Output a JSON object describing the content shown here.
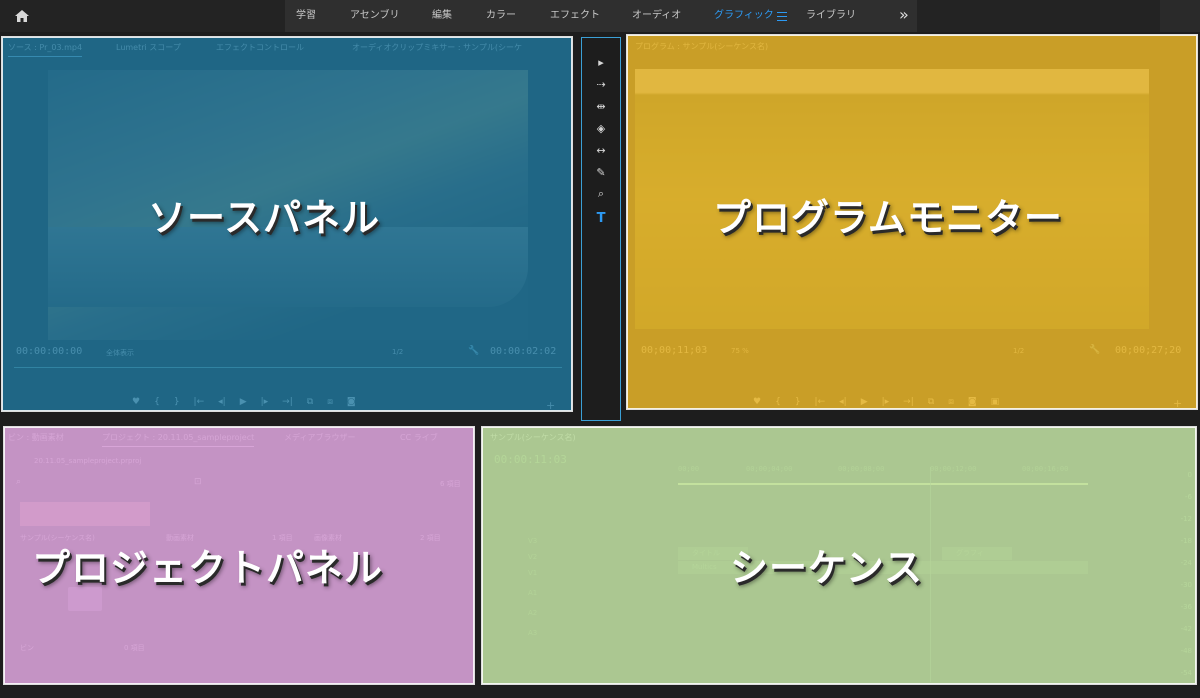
{
  "topbar": {
    "home_icon": "home-icon",
    "workspaces": [
      {
        "label": "学習"
      },
      {
        "label": "アセンブリ"
      },
      {
        "label": "編集"
      },
      {
        "label": "カラー"
      },
      {
        "label": "エフェクト"
      },
      {
        "label": "オーディオ"
      },
      {
        "label": "グラフィック",
        "active": true
      },
      {
        "label": "ライブラリ"
      }
    ],
    "more": "»"
  },
  "source_panel": {
    "tabs": [
      "ソース : Pr_03.mp4",
      "Lumetri スコープ",
      "エフェクトコントロール",
      "オーディオクリップミキサー : サンプル(シーケ"
    ],
    "overlay_title": "ソースパネル",
    "timecode_left": "00:00:00:00",
    "zoom": "全体表示",
    "fraction": "1/2",
    "timecode_right": "00:00:02:02",
    "overlay_color": "#1e78a0"
  },
  "tools_panel": {
    "tools": [
      "▸",
      "⇢",
      "⇹",
      "◈",
      "↔",
      "✎",
      "⌕",
      "T"
    ]
  },
  "program_panel": {
    "tab": "プログラム : サンプル(シーケンス名)",
    "overlay_title": "プログラムモニター",
    "timecode_left": "00;00;11;03",
    "zoom": "75 %",
    "fraction": "1/2",
    "timecode_right": "00;00;27;20",
    "overlay_color": "#e4b228"
  },
  "project_panel": {
    "tabs": [
      "ビン : 動画素材",
      "プロジェクト : 20.11.05_sampleproject",
      "メディアブラウザー",
      "CC ライブ"
    ],
    "file": "20.11.05_sampleproject.prproj",
    "count": "6 項目",
    "row_labels": [
      "サンプル(シーケンス名)",
      "動画素材",
      "1 項目",
      "画像素材",
      "2 項目"
    ],
    "bin_label": "ビン",
    "bin_count": "0 項目",
    "overlay_title": "プロジェクトパネル",
    "overlay_color": "#d6a0d6"
  },
  "sequence_panel": {
    "tab": "サンプル(シーケンス名)",
    "timecode": "00:00:11:03",
    "ruler": [
      "00;00",
      "00;00;04;00",
      "00;00;08;00",
      "00;00;12;00",
      "00;00;16;00"
    ],
    "tracks": [
      "V3",
      "V2",
      "V1",
      "A1",
      "A2",
      "A3"
    ],
    "clips": [
      "タイトル",
      "Multics",
      "グラフィ"
    ],
    "meter_labels": [
      "0",
      "-6",
      "-12",
      "-18",
      "-24",
      "-30",
      "-36",
      "-42",
      "-48",
      "-54"
    ],
    "overlay_title": "シーケンス",
    "overlay_color": "#bedea0"
  }
}
